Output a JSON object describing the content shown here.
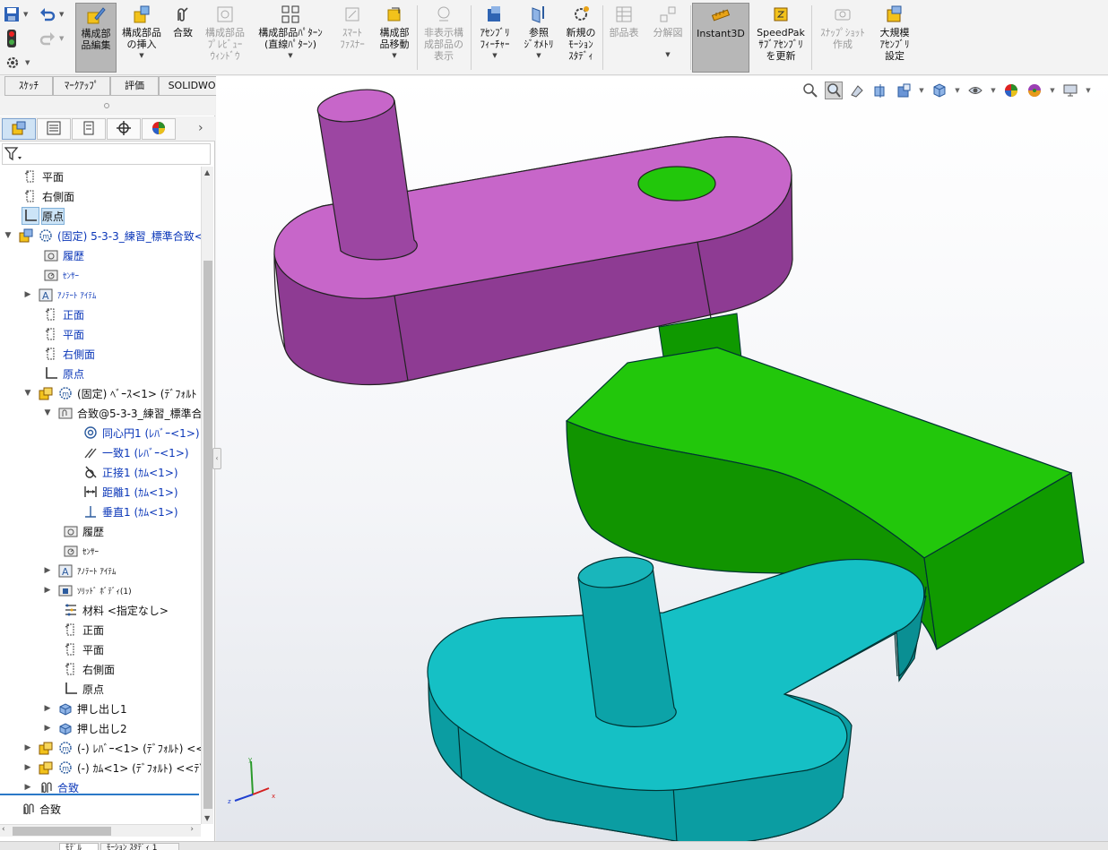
{
  "ribbon": {
    "buttons": [
      {
        "label": "構成部\n品編集",
        "icon": "edit-component-icon",
        "active": true,
        "disabled": false
      },
      {
        "label": "構成部品\nの挿入",
        "icon": "insert-component-icon",
        "active": false,
        "disabled": false
      },
      {
        "label": "合致",
        "icon": "mate-icon",
        "active": false,
        "disabled": false
      },
      {
        "label": "構成部品\nﾌﾟﾚﾋﾞｭｰ\nｳｨﾝﾄﾞｳ",
        "icon": "component-preview-icon",
        "active": false,
        "disabled": true
      },
      {
        "label": "構成部品ﾊﾟﾀｰﾝ\n(直線ﾊﾟﾀｰﾝ)",
        "icon": "linear-pattern-icon",
        "active": false,
        "disabled": false
      },
      {
        "label": "ｽﾏｰﾄ\nﾌｧｽﾅｰ",
        "icon": "smart-fastener-icon",
        "active": false,
        "disabled": true
      },
      {
        "label": "構成部\n品移動",
        "icon": "move-component-icon",
        "active": false,
        "disabled": false
      },
      {
        "label": "非表示構\n成部品の\n表示",
        "icon": "show-hidden-icon",
        "active": false,
        "disabled": true
      },
      {
        "label": "ｱｾﾝﾌﾞﾘ\nﾌｨｰﾁｬｰ",
        "icon": "assembly-feature-icon",
        "active": false,
        "disabled": false
      },
      {
        "label": "参照\nｼﾞｵﾒﾄﾘ",
        "icon": "reference-geometry-icon",
        "active": false,
        "disabled": false
      },
      {
        "label": "新規の\nﾓｰｼｮﾝ\nｽﾀﾃﾞｨ",
        "icon": "motion-study-icon",
        "active": false,
        "disabled": false
      },
      {
        "label": "部品表",
        "icon": "bom-icon",
        "active": false,
        "disabled": true
      },
      {
        "label": "分解図",
        "icon": "exploded-view-icon",
        "active": false,
        "disabled": true
      },
      {
        "label": "Instant3D",
        "icon": "instant3d-icon",
        "active": true,
        "disabled": false
      },
      {
        "label": "SpeedPak\nｻﾌﾞｱｾﾝﾌﾞﾘ\nを更新",
        "icon": "speedpak-icon",
        "active": false,
        "disabled": false
      },
      {
        "label": "ｽﾅｯﾌﾟｼｮｯﾄ\n作成",
        "icon": "snapshot-icon",
        "active": false,
        "disabled": true
      },
      {
        "label": "大規模\nｱｾﾝﾌﾞﾘ\n設定",
        "icon": "large-assembly-icon",
        "active": false,
        "disabled": false
      }
    ]
  },
  "command_tabs": [
    "ｽｹｯﾁ",
    "ﾏｰｸｱｯﾌﾟ",
    "評価",
    "SOLIDWORKS ｱﾄﾞｲﾝ"
  ],
  "tree": [
    {
      "label": "平面",
      "icon": "plane-icon",
      "blue": false,
      "small": false
    },
    {
      "label": "右側面",
      "icon": "plane-icon",
      "blue": false,
      "small": false
    },
    {
      "label": "原点",
      "icon": "origin-icon",
      "blue": false,
      "small": false,
      "selected": true
    },
    {
      "label": "(固定) 5-3-3_練習_標準合致<",
      "icon": "subassembly-icon",
      "blue": true,
      "small": false,
      "expanded": true
    },
    {
      "label": "履歴",
      "icon": "history-icon",
      "blue": true,
      "small": false
    },
    {
      "label": "ｾﾝｻｰ",
      "icon": "sensor-icon",
      "blue": true,
      "small": true
    },
    {
      "label": "ｱﾉﾃｰﾄ ｱｲﾃﾑ",
      "icon": "annotation-icon",
      "blue": true,
      "small": true,
      "collapsed": true
    },
    {
      "label": "正面",
      "icon": "plane-icon",
      "blue": true,
      "small": false
    },
    {
      "label": "平面",
      "icon": "plane-icon",
      "blue": true,
      "small": false
    },
    {
      "label": "右側面",
      "icon": "plane-icon",
      "blue": true,
      "small": false
    },
    {
      "label": "原点",
      "icon": "origin-icon",
      "blue": true,
      "small": false
    },
    {
      "label": "(固定) ﾍﾞｰｽ<1> (ﾃﾞﾌｫﾙﾄ",
      "icon": "part-icon",
      "blue": false,
      "small": false,
      "expanded": true
    },
    {
      "label": "合致@5-3-3_練習_標準合",
      "icon": "mates-folder-icon",
      "blue": false,
      "small": false,
      "expanded": true
    },
    {
      "label": "同心円1 (ﾚﾊﾞｰ<1>)",
      "icon": "concentric-mate-icon",
      "blue": true,
      "small": false
    },
    {
      "label": "一致1 (ﾚﾊﾞｰ<1>)",
      "icon": "coincident-mate-icon",
      "blue": true,
      "small": false
    },
    {
      "label": "正接1 (ｶﾑ<1>)",
      "icon": "tangent-mate-icon",
      "blue": true,
      "small": false
    },
    {
      "label": "距離1 (ｶﾑ<1>)",
      "icon": "distance-mate-icon",
      "blue": true,
      "small": false
    },
    {
      "label": "垂直1 (ｶﾑ<1>)",
      "icon": "perpendicular-mate-icon",
      "blue": true,
      "small": false
    },
    {
      "label": "履歴",
      "icon": "history-icon",
      "blue": false,
      "small": false
    },
    {
      "label": "ｾﾝｻｰ",
      "icon": "sensor-icon",
      "blue": false,
      "small": true
    },
    {
      "label": "ｱﾉﾃｰﾄ ｱｲﾃﾑ",
      "icon": "annotation-icon",
      "blue": false,
      "small": true,
      "collapsed": true
    },
    {
      "label": "ｿﾘｯﾄﾞ ﾎﾞﾃﾞｨ(1)",
      "icon": "solid-body-icon",
      "blue": false,
      "small": true,
      "collapsed": true
    },
    {
      "label": "材料 <指定なし>",
      "icon": "material-icon",
      "blue": false,
      "small": false
    },
    {
      "label": "正面",
      "icon": "plane-icon",
      "blue": false,
      "small": false
    },
    {
      "label": "平面",
      "icon": "plane-icon",
      "blue": false,
      "small": false
    },
    {
      "label": "右側面",
      "icon": "plane-icon",
      "blue": false,
      "small": false
    },
    {
      "label": "原点",
      "icon": "origin-icon",
      "blue": false,
      "small": false
    },
    {
      "label": "押し出し1",
      "icon": "extrude-icon",
      "blue": false,
      "small": false,
      "collapsed": true
    },
    {
      "label": "押し出し2",
      "icon": "extrude-icon",
      "blue": false,
      "small": false,
      "collapsed": true
    },
    {
      "label": "(-) ﾚﾊﾞｰ<1> (ﾃﾞﾌｫﾙﾄ) <<",
      "icon": "part-icon",
      "blue": false,
      "small": false,
      "collapsed": true
    },
    {
      "label": "(-) ｶﾑ<1> (ﾃﾞﾌｫﾙﾄ) <<ﾃﾞ",
      "icon": "part-icon",
      "blue": false,
      "small": false,
      "collapsed": true
    },
    {
      "label": "合致",
      "icon": "mates-icon",
      "blue": true,
      "small": false,
      "collapsed": true
    },
    {
      "label": "合致",
      "icon": "mates-icon",
      "blue": false,
      "small": false
    }
  ],
  "bottom_tabs": [
    "ﾓﾃﾞﾙ",
    "ﾓｰｼｮﾝ ｽﾀﾃﾞｨ 1"
  ],
  "colors": {
    "lever": "#b55cb8",
    "cam": "#18b000",
    "base": "#13bdc2",
    "accent": "#2b79c7"
  }
}
